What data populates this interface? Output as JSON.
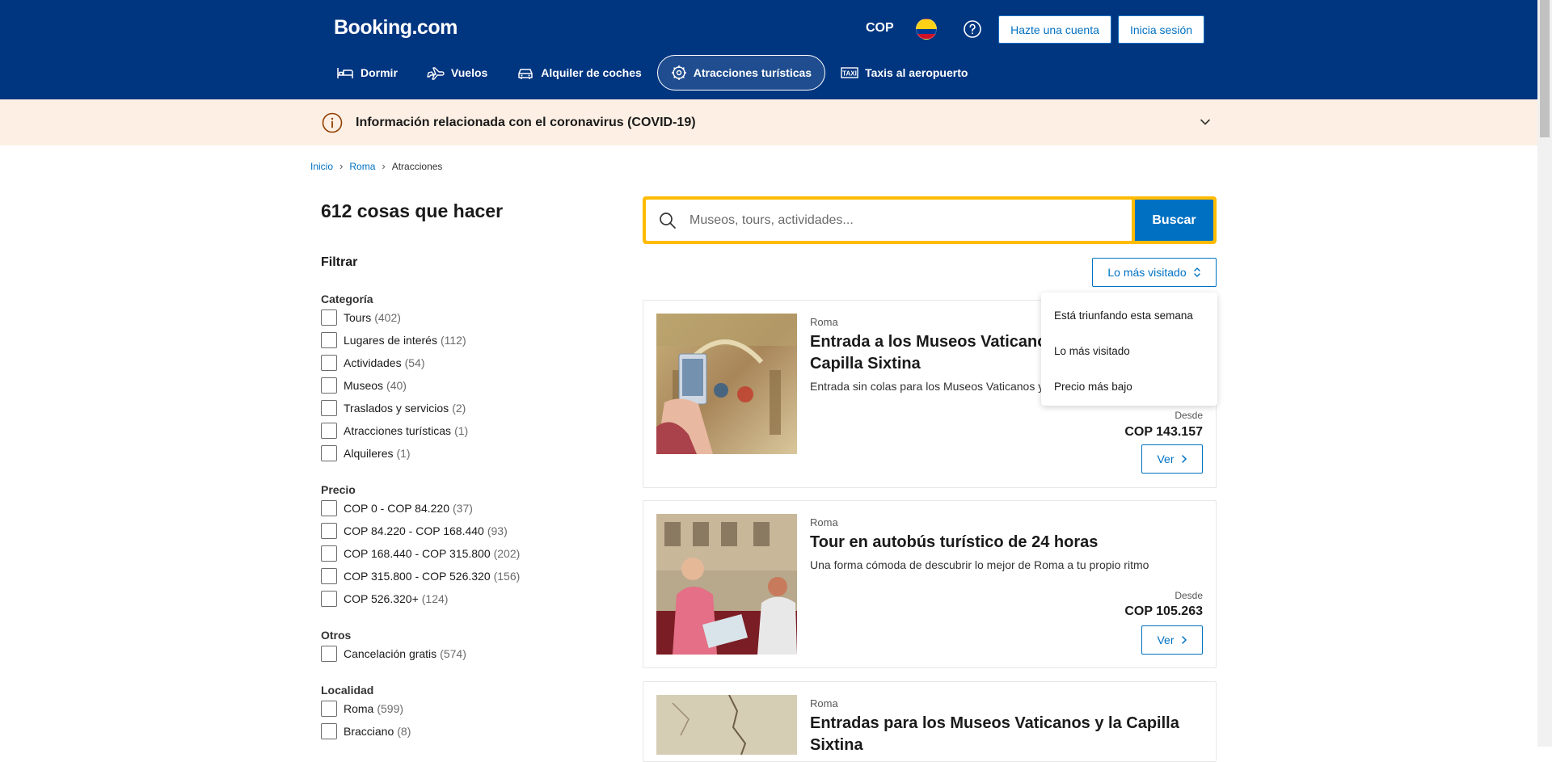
{
  "header": {
    "logo": "Booking.com",
    "currency": "COP",
    "signup_label": "Hazte una cuenta",
    "login_label": "Inicia sesión",
    "nav": [
      {
        "label": "Dormir",
        "icon": "bed-icon"
      },
      {
        "label": "Vuelos",
        "icon": "plane-icon"
      },
      {
        "label": "Alquiler de coches",
        "icon": "car-icon"
      },
      {
        "label": "Atracciones turísticas",
        "icon": "attractions-icon",
        "active": true
      },
      {
        "label": "Taxis al aeropuerto",
        "icon": "taxi-icon"
      }
    ]
  },
  "covid_banner": {
    "text": "Información relacionada con el coronavirus (COVID-19)"
  },
  "breadcrumb": {
    "items": [
      "Inicio",
      "Roma",
      "Atracciones"
    ]
  },
  "results_title": "612 cosas que hacer",
  "filter": {
    "title": "Filtrar",
    "groups": [
      {
        "title": "Categoría",
        "options": [
          {
            "label": "Tours",
            "count": "(402)"
          },
          {
            "label": "Lugares de interés",
            "count": "(112)"
          },
          {
            "label": "Actividades",
            "count": "(54)"
          },
          {
            "label": "Museos",
            "count": "(40)"
          },
          {
            "label": "Traslados y servicios",
            "count": "(2)"
          },
          {
            "label": "Atracciones turísticas",
            "count": "(1)"
          },
          {
            "label": "Alquileres",
            "count": "(1)"
          }
        ]
      },
      {
        "title": "Precio",
        "options": [
          {
            "label": "COP 0 - COP 84.220",
            "count": "(37)"
          },
          {
            "label": "COP 84.220 - COP 168.440",
            "count": "(93)"
          },
          {
            "label": "COP 168.440 - COP 315.800",
            "count": "(202)"
          },
          {
            "label": "COP 315.800 - COP 526.320",
            "count": "(156)"
          },
          {
            "label": "COP 526.320+",
            "count": "(124)"
          }
        ]
      },
      {
        "title": "Otros",
        "options": [
          {
            "label": "Cancelación gratis",
            "count": "(574)"
          }
        ]
      },
      {
        "title": "Localidad",
        "options": [
          {
            "label": "Roma",
            "count": "(599)"
          },
          {
            "label": "Bracciano",
            "count": "(8)"
          }
        ]
      }
    ]
  },
  "search": {
    "placeholder": "Museos, tours, actividades...",
    "button_label": "Buscar"
  },
  "sort": {
    "label": "Lo más visitado",
    "options": [
      "Está triunfando esta semana",
      "Lo más visitado",
      "Precio más bajo"
    ]
  },
  "cards": [
    {
      "location": "Roma",
      "title": "Entrada a los Museos Vaticanos y la Capilla Sixtina",
      "description": "Entrada sin colas para los Museos Vaticanos y la Capilla Sixtina",
      "from_label": "Desde",
      "price": "COP 143.157",
      "button_label": "Ver"
    },
    {
      "location": "Roma",
      "title": "Tour en autobús turístico de 24 horas",
      "description": "Una forma cómoda de descubrir lo mejor de Roma a tu propio ritmo",
      "from_label": "Desde",
      "price": "COP 105.263",
      "button_label": "Ver"
    },
    {
      "location": "Roma",
      "title": "Entradas para los Museos Vaticanos y la Capilla Sixtina",
      "description": "",
      "from_label": "",
      "price": "",
      "button_label": ""
    }
  ],
  "colors": {
    "brand_blue": "#003580",
    "action_blue": "#0071c2",
    "search_border": "#febb02",
    "covid_bg": "#fdefe3"
  }
}
